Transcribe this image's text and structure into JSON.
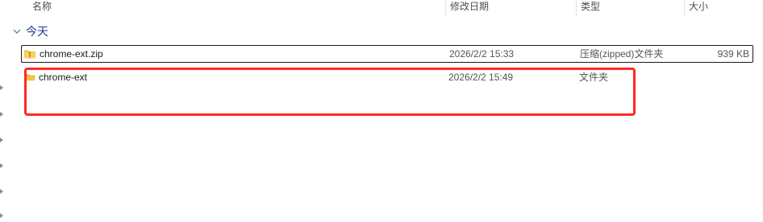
{
  "columns": {
    "name": "名称",
    "date_modified": "修改日期",
    "type": "类型",
    "size": "大小"
  },
  "group": {
    "label": "今天"
  },
  "files": [
    {
      "name": "chrome-ext.zip",
      "date_modified": "2026/2/2 15:33",
      "type": "压缩(zipped)文件夹",
      "size": "939 KB",
      "icon": "zip-folder-icon",
      "selected": true
    },
    {
      "name": "chrome-ext",
      "date_modified": "2026/2/2 15:49",
      "type": "文件夹",
      "size": "",
      "icon": "folder-icon",
      "selected": false
    }
  ],
  "colors": {
    "accent_group": "#1e3c8c",
    "folder": "#f4c442",
    "folder_dark": "#e0a82e",
    "annotation": "#ff2a22"
  }
}
